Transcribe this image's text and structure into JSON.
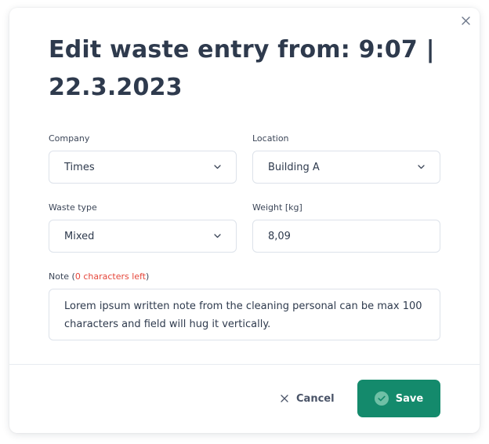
{
  "dialog": {
    "title": "Edit waste entry from: 9:07 | 22.3.2023",
    "close_icon": "close-icon"
  },
  "fields": {
    "company": {
      "label": "Company",
      "value": "Times"
    },
    "location": {
      "label": "Location",
      "value": "Building A"
    },
    "waste_type": {
      "label": "Waste type",
      "value": "Mixed"
    },
    "weight": {
      "label": "Weight [kg]",
      "value": "8,09"
    },
    "note": {
      "label_prefix": "Note (",
      "label_counter": "0 characters left",
      "label_suffix": ")",
      "value": "Lorem ipsum written note from the cleaning personal can be max 100 characters and field will hug it vertically."
    }
  },
  "actions": {
    "cancel_label": "Cancel",
    "save_label": "Save"
  },
  "colors": {
    "title": "#2e3a4d",
    "primary": "#148a6c",
    "warning": "#e5463a",
    "border": "#dde2ea"
  }
}
